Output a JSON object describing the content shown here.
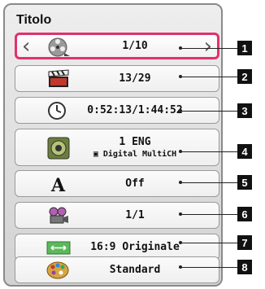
{
  "menu": {
    "title": "Titolo",
    "rows": [
      {
        "value": "1/10",
        "icon": "film-reel-icon",
        "index_label": "1"
      },
      {
        "value": "13/29",
        "icon": "clapperboard-icon",
        "index_label": "2"
      },
      {
        "value": "0:52:13/1:44:52",
        "icon": "clock-icon",
        "index_label": "3"
      },
      {
        "value_line1": "1 ENG",
        "value_line2": "▣ Digital   MultiCH",
        "icon": "speaker-icon",
        "index_label": "4"
      },
      {
        "value": "Off",
        "icon": "subtitle-letter-icon",
        "index_label": "5"
      },
      {
        "value": "1/1",
        "icon": "camera-angle-icon",
        "index_label": "6"
      },
      {
        "value": "16:9 Originale",
        "icon": "aspect-ratio-icon",
        "index_label": "7"
      },
      {
        "value": "Standard",
        "icon": "palette-icon",
        "index_label": "8"
      }
    ],
    "nav": {
      "prev": "‹",
      "next": "›"
    }
  },
  "colors": {
    "accent": "#e2306e"
  }
}
